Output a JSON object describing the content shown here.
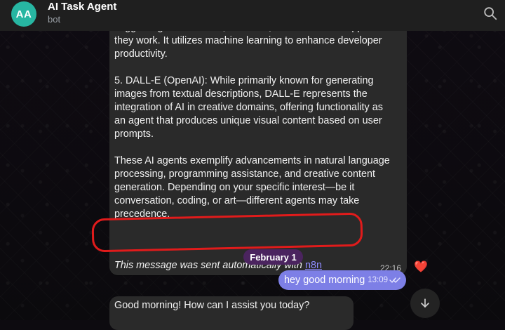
{
  "header": {
    "avatar_initials": "AA",
    "title": "AI Task Agent",
    "subtitle": "bot"
  },
  "messages": {
    "first": {
      "line_cutoff": "suggesting lines of code, functions, or entire code snippets as",
      "line_work": "they work. It utilizes machine learning to enhance developer",
      "line_productivity": "productivity.",
      "item5": "5. DALL-E (OpenAI): While primarily known for generating images from textual descriptions, DALL-E represents the integration of AI in creative domains, offering functionality as an agent that produces unique visual content based on user prompts.",
      "summary": "These AI agents exemplify advancements in natural language processing, programming assistance, and creative content generation. Depending on your specific interest—be it conversation, coding, or art—different agents may take precedence.",
      "auto_prefix": "This message was sent automatically with ",
      "auto_link": "n8n",
      "time": "22:16",
      "reaction": "❤️"
    },
    "date_separator": "February 1",
    "user_reply": {
      "text": "hey good morning",
      "time": "13:09"
    },
    "bot_reply": {
      "text": "Good morning! How can I assist you today?"
    }
  },
  "icons": {
    "search": "search-icon",
    "scroll_down": "chevron-down-icon",
    "double_check": "double-check-icon"
  },
  "colors": {
    "avatar": "#27b6a2",
    "header_bg": "#1f1f1f",
    "bot_bubble": "#2a2a2a",
    "user_bubble": "#7d7fe6",
    "date_chip": "#4b245f",
    "annotation": "#e11b1b",
    "link": "#8f8cff"
  }
}
